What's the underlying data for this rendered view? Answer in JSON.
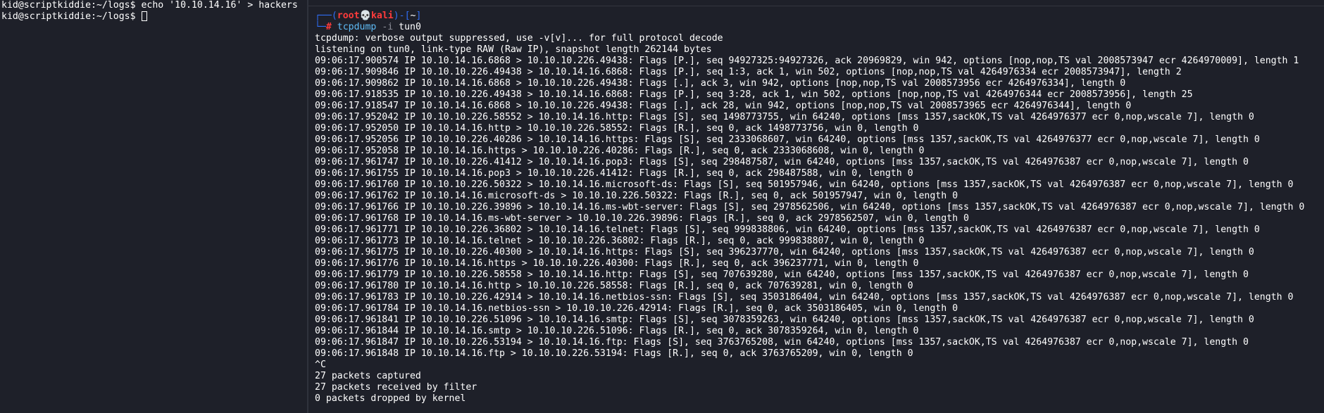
{
  "left_terminal": {
    "lines": [
      "kid@scriptkiddie:~/logs$ echo '10.10.14.16' > hackers",
      "kid@scriptkiddie:~/logs$ "
    ]
  },
  "right_terminal": {
    "prompt": {
      "open": "┌──(",
      "user": "root",
      "skull": "💀",
      "host": "kali",
      "mid": ")-[",
      "dir": "~",
      "close": "]",
      "hash_prefix": "└─",
      "hash": "#",
      "command": "tcpdump",
      "option": "-i",
      "argument": "tun0"
    },
    "lines": [
      "tcpdump: verbose output suppressed, use -v[v]... for full protocol decode",
      "listening on tun0, link-type RAW (Raw IP), snapshot length 262144 bytes",
      "09:06:17.900574 IP 10.10.14.16.6868 > 10.10.10.226.49438: Flags [P.], seq 94927325:94927326, ack 20969829, win 942, options [nop,nop,TS val 2008573947 ecr 4264970009], length 1",
      "09:06:17.909846 IP 10.10.10.226.49438 > 10.10.14.16.6868: Flags [P.], seq 1:3, ack 1, win 502, options [nop,nop,TS val 4264976334 ecr 2008573947], length 2",
      "09:06:17.909862 IP 10.10.14.16.6868 > 10.10.10.226.49438: Flags [.], ack 3, win 942, options [nop,nop,TS val 2008573956 ecr 4264976334], length 0",
      "09:06:17.918535 IP 10.10.10.226.49438 > 10.10.14.16.6868: Flags [P.], seq 3:28, ack 1, win 502, options [nop,nop,TS val 4264976344 ecr 2008573956], length 25",
      "09:06:17.918547 IP 10.10.14.16.6868 > 10.10.10.226.49438: Flags [.], ack 28, win 942, options [nop,nop,TS val 2008573965 ecr 4264976344], length 0",
      "09:06:17.952042 IP 10.10.10.226.58552 > 10.10.14.16.http: Flags [S], seq 1498773755, win 64240, options [mss 1357,sackOK,TS val 4264976377 ecr 0,nop,wscale 7], length 0",
      "09:06:17.952050 IP 10.10.14.16.http > 10.10.10.226.58552: Flags [R.], seq 0, ack 1498773756, win 0, length 0",
      "09:06:17.952056 IP 10.10.10.226.40286 > 10.10.14.16.https: Flags [S], seq 2333068607, win 64240, options [mss 1357,sackOK,TS val 4264976377 ecr 0,nop,wscale 7], length 0",
      "09:06:17.952058 IP 10.10.14.16.https > 10.10.10.226.40286: Flags [R.], seq 0, ack 2333068608, win 0, length 0",
      "09:06:17.961747 IP 10.10.10.226.41412 > 10.10.14.16.pop3: Flags [S], seq 298487587, win 64240, options [mss 1357,sackOK,TS val 4264976387 ecr 0,nop,wscale 7], length 0",
      "09:06:17.961755 IP 10.10.14.16.pop3 > 10.10.10.226.41412: Flags [R.], seq 0, ack 298487588, win 0, length 0",
      "09:06:17.961760 IP 10.10.10.226.50322 > 10.10.14.16.microsoft-ds: Flags [S], seq 501957946, win 64240, options [mss 1357,sackOK,TS val 4264976387 ecr 0,nop,wscale 7], length 0",
      "09:06:17.961762 IP 10.10.14.16.microsoft-ds > 10.10.10.226.50322: Flags [R.], seq 0, ack 501957947, win 0, length 0",
      "09:06:17.961766 IP 10.10.10.226.39896 > 10.10.14.16.ms-wbt-server: Flags [S], seq 2978562506, win 64240, options [mss 1357,sackOK,TS val 4264976387 ecr 0,nop,wscale 7], length 0",
      "09:06:17.961768 IP 10.10.14.16.ms-wbt-server > 10.10.10.226.39896: Flags [R.], seq 0, ack 2978562507, win 0, length 0",
      "09:06:17.961771 IP 10.10.10.226.36802 > 10.10.14.16.telnet: Flags [S], seq 999838806, win 64240, options [mss 1357,sackOK,TS val 4264976387 ecr 0,nop,wscale 7], length 0",
      "09:06:17.961773 IP 10.10.14.16.telnet > 10.10.10.226.36802: Flags [R.], seq 0, ack 999838807, win 0, length 0",
      "09:06:17.961775 IP 10.10.10.226.40300 > 10.10.14.16.https: Flags [S], seq 396237770, win 64240, options [mss 1357,sackOK,TS val 4264976387 ecr 0,nop,wscale 7], length 0",
      "09:06:17.961776 IP 10.10.14.16.https > 10.10.10.226.40300: Flags [R.], seq 0, ack 396237771, win 0, length 0",
      "09:06:17.961779 IP 10.10.10.226.58558 > 10.10.14.16.http: Flags [S], seq 707639280, win 64240, options [mss 1357,sackOK,TS val 4264976387 ecr 0,nop,wscale 7], length 0",
      "09:06:17.961780 IP 10.10.14.16.http > 10.10.10.226.58558: Flags [R.], seq 0, ack 707639281, win 0, length 0",
      "09:06:17.961783 IP 10.10.10.226.42914 > 10.10.14.16.netbios-ssn: Flags [S], seq 3503186404, win 64240, options [mss 1357,sackOK,TS val 4264976387 ecr 0,nop,wscale 7], length 0",
      "09:06:17.961784 IP 10.10.14.16.netbios-ssn > 10.10.10.226.42914: Flags [R.], seq 0, ack 3503186405, win 0, length 0",
      "09:06:17.961841 IP 10.10.10.226.51096 > 10.10.14.16.smtp: Flags [S], seq 3078359263, win 64240, options [mss 1357,sackOK,TS val 4264976387 ecr 0,nop,wscale 7], length 0",
      "09:06:17.961844 IP 10.10.14.16.smtp > 10.10.10.226.51096: Flags [R.], seq 0, ack 3078359264, win 0, length 0",
      "09:06:17.961847 IP 10.10.10.226.53194 > 10.10.14.16.ftp: Flags [S], seq 3763765208, win 64240, options [mss 1357,sackOK,TS val 4264976387 ecr 0,nop,wscale 7], length 0",
      "09:06:17.961848 IP 10.10.14.16.ftp > 10.10.10.226.53194: Flags [R.], seq 0, ack 3763765209, win 0, length 0",
      "^C",
      "27 packets captured",
      "27 packets received by filter",
      "0 packets dropped by kernel"
    ]
  },
  "colors": {
    "background": "#1e2029",
    "prompt_frame": "#2f6ef5",
    "prompt_user": "#ff3b3b",
    "prompt_command": "#5fbcf7"
  }
}
